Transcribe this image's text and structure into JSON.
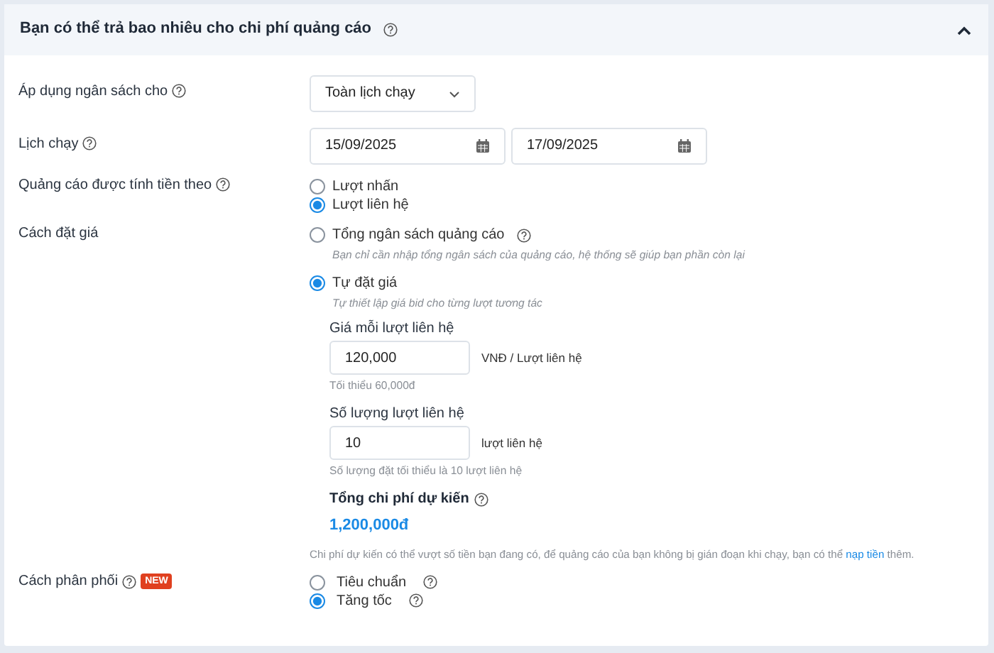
{
  "section": {
    "title": "Bạn có thể trả bao nhiêu cho chi phí quảng cáo",
    "help": true,
    "expanded": true
  },
  "budget_scope": {
    "label": "Áp dụng ngân sách cho",
    "help": true,
    "value": "Toàn lịch chạy"
  },
  "schedule": {
    "label": "Lịch chạy",
    "help": true,
    "start_date": "15/09/2025",
    "end_date": "17/09/2025"
  },
  "billing": {
    "label": "Quảng cáo được tính tiền theo",
    "help": true,
    "options": [
      {
        "label": "Lượt nhấn",
        "help": false,
        "selected": false
      },
      {
        "label": "Lượt liên hệ",
        "help": false,
        "selected": true
      }
    ]
  },
  "bidding": {
    "label": "Cách đặt giá",
    "help": false,
    "options": [
      {
        "label": "Tổng ngân sách quảng cáo",
        "help": true,
        "description": "Bạn chỉ cần nhập tổng ngân sách của quảng cáo, hệ thống sẽ giúp bạn phần còn lại",
        "selected": false
      },
      {
        "label": "Tự đặt giá",
        "help": false,
        "description": "Tự thiết lập giá bid cho từng lượt tương tác",
        "selected": true
      }
    ],
    "fields": [
      {
        "label": "Giá mỗi lượt liên hệ",
        "value": "120,000",
        "unit": "VNĐ / Lượt liên hệ",
        "hint": "Tối thiểu 60,000đ"
      },
      {
        "label": "Số lượng lượt liên hệ",
        "value": "10",
        "unit": "lượt liên hệ",
        "hint": "Số lượng đặt tối thiểu là 10 lượt liên hệ"
      }
    ],
    "total": {
      "label": "Tổng chi phí dự kiến",
      "help": true,
      "value": "1,200,000đ"
    },
    "note": {
      "text": "Chi phí dự kiến có thể vượt số tiền bạn đang có, để quảng cáo của bạn không bị gián đoạn khi chạy, bạn có thể",
      "link": "nạp tiền",
      "text_end": "thêm."
    }
  },
  "delivery": {
    "label": "Cách phân phối",
    "help": true,
    "badge": "NEW",
    "options": [
      {
        "label": "Tiêu chuẩn",
        "help": true,
        "selected": false
      },
      {
        "label": "Tăng tốc",
        "help": true,
        "selected": true
      }
    ]
  }
}
